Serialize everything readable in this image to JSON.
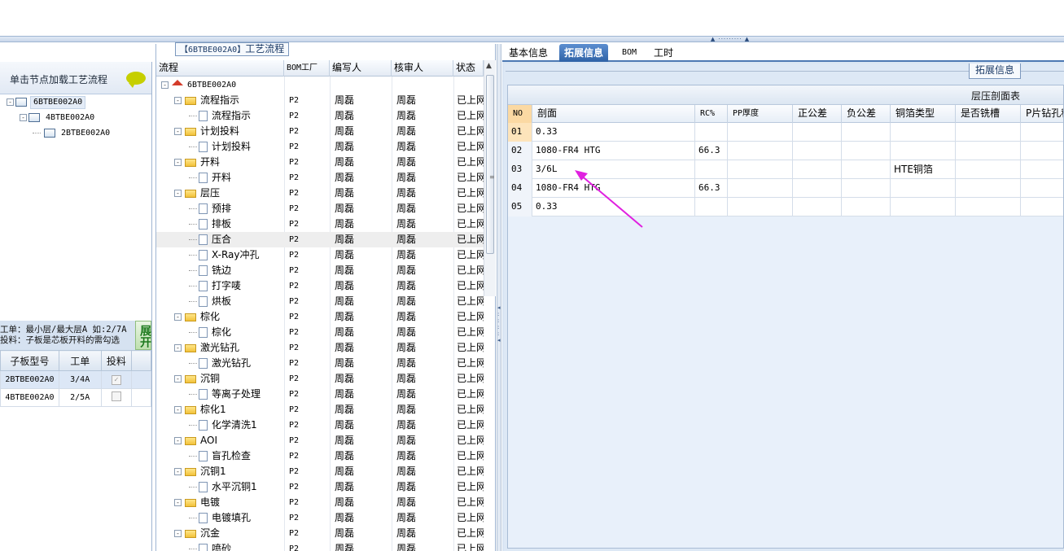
{
  "left": {
    "hint": "单击节点加载工艺流程",
    "tree": [
      {
        "label": "6BTBE002A0",
        "expander": "-",
        "level": 0,
        "selected": true
      },
      {
        "label": "4BTBE002A0",
        "expander": "-",
        "level": 1,
        "selected": false
      },
      {
        "label": "2BTBE002A0",
        "expander": "",
        "level": 2,
        "selected": false
      }
    ],
    "note_line1": "工单：最小层/最大层A 如:2/7A",
    "note_line2": "投料：子板是芯板开料的需勾选",
    "expand_label": "展开",
    "sub_headers": [
      "子板型号",
      "工单",
      "投料"
    ],
    "sub_rows": [
      {
        "model": "2BTBE002A0",
        "order": "3/4A",
        "checked": true
      },
      {
        "model": "4BTBE002A0",
        "order": "2/5A",
        "checked": false
      }
    ]
  },
  "middle": {
    "title_prefix": "【6BTBE002A0】",
    "title_suffix": "工艺流程",
    "headers": [
      "流程",
      "BOM工厂",
      "编写人",
      "核审人",
      "状态"
    ],
    "rows": [
      {
        "name": "6BTBE002A0",
        "type": "root",
        "bom": "",
        "writer": "",
        "reviewer": "",
        "status": ""
      },
      {
        "name": "流程指示",
        "type": "folder",
        "bom": "P2",
        "writer": "周磊",
        "reviewer": "周磊",
        "status": "已上网"
      },
      {
        "name": "流程指示",
        "type": "doc",
        "bom": "P2",
        "writer": "周磊",
        "reviewer": "周磊",
        "status": "已上网"
      },
      {
        "name": "计划投料",
        "type": "folder",
        "bom": "P2",
        "writer": "周磊",
        "reviewer": "周磊",
        "status": "已上网"
      },
      {
        "name": "计划投料",
        "type": "doc",
        "bom": "P2",
        "writer": "周磊",
        "reviewer": "周磊",
        "status": "已上网"
      },
      {
        "name": "开料",
        "type": "folder",
        "bom": "P2",
        "writer": "周磊",
        "reviewer": "周磊",
        "status": "已上网"
      },
      {
        "name": "开料",
        "type": "doc",
        "bom": "P2",
        "writer": "周磊",
        "reviewer": "周磊",
        "status": "已上网"
      },
      {
        "name": "层压",
        "type": "folder",
        "bom": "P2",
        "writer": "周磊",
        "reviewer": "周磊",
        "status": "已上网"
      },
      {
        "name": "预排",
        "type": "doc",
        "bom": "P2",
        "writer": "周磊",
        "reviewer": "周磊",
        "status": "已上网"
      },
      {
        "name": "排板",
        "type": "doc",
        "bom": "P2",
        "writer": "周磊",
        "reviewer": "周磊",
        "status": "已上网"
      },
      {
        "name": "压合",
        "type": "doc",
        "bom": "P2",
        "writer": "周磊",
        "reviewer": "周磊",
        "status": "已上网",
        "selected": true
      },
      {
        "name": "X-Ray冲孔",
        "type": "doc",
        "bom": "P2",
        "writer": "周磊",
        "reviewer": "周磊",
        "status": "已上网"
      },
      {
        "name": "铣边",
        "type": "doc",
        "bom": "P2",
        "writer": "周磊",
        "reviewer": "周磊",
        "status": "已上网"
      },
      {
        "name": "打字唛",
        "type": "doc",
        "bom": "P2",
        "writer": "周磊",
        "reviewer": "周磊",
        "status": "已上网"
      },
      {
        "name": "烘板",
        "type": "doc",
        "bom": "P2",
        "writer": "周磊",
        "reviewer": "周磊",
        "status": "已上网"
      },
      {
        "name": "棕化",
        "type": "folder",
        "bom": "P2",
        "writer": "周磊",
        "reviewer": "周磊",
        "status": "已上网"
      },
      {
        "name": "棕化",
        "type": "doc",
        "bom": "P2",
        "writer": "周磊",
        "reviewer": "周磊",
        "status": "已上网"
      },
      {
        "name": "激光钻孔",
        "type": "folder",
        "bom": "P2",
        "writer": "周磊",
        "reviewer": "周磊",
        "status": "已上网"
      },
      {
        "name": "激光钻孔",
        "type": "doc",
        "bom": "P2",
        "writer": "周磊",
        "reviewer": "周磊",
        "status": "已上网"
      },
      {
        "name": "沉铜",
        "type": "folder",
        "bom": "P2",
        "writer": "周磊",
        "reviewer": "周磊",
        "status": "已上网"
      },
      {
        "name": "等离子处理",
        "type": "doc",
        "bom": "P2",
        "writer": "周磊",
        "reviewer": "周磊",
        "status": "已上网"
      },
      {
        "name": "棕化1",
        "type": "folder",
        "bom": "P2",
        "writer": "周磊",
        "reviewer": "周磊",
        "status": "已上网"
      },
      {
        "name": "化学清洗1",
        "type": "doc",
        "bom": "P2",
        "writer": "周磊",
        "reviewer": "周磊",
        "status": "已上网"
      },
      {
        "name": "AOI",
        "type": "folder",
        "bom": "P2",
        "writer": "周磊",
        "reviewer": "周磊",
        "status": "已上网"
      },
      {
        "name": "盲孔检查",
        "type": "doc",
        "bom": "P2",
        "writer": "周磊",
        "reviewer": "周磊",
        "status": "已上网"
      },
      {
        "name": "沉铜1",
        "type": "folder",
        "bom": "P2",
        "writer": "周磊",
        "reviewer": "周磊",
        "status": "已上网"
      },
      {
        "name": "水平沉铜1",
        "type": "doc",
        "bom": "P2",
        "writer": "周磊",
        "reviewer": "周磊",
        "status": "已上网"
      },
      {
        "name": "电镀",
        "type": "folder",
        "bom": "P2",
        "writer": "周磊",
        "reviewer": "周磊",
        "status": "已上网"
      },
      {
        "name": "电镀填孔",
        "type": "doc",
        "bom": "P2",
        "writer": "周磊",
        "reviewer": "周磊",
        "status": "已上网"
      },
      {
        "name": "沉金",
        "type": "folder",
        "bom": "P2",
        "writer": "周磊",
        "reviewer": "周磊",
        "status": "已上网"
      },
      {
        "name": "喷砂",
        "type": "doc",
        "bom": "P2",
        "writer": "周磊",
        "reviewer": "周磊",
        "status": "已上网"
      }
    ]
  },
  "right": {
    "tabs": [
      {
        "label": "基本信息",
        "active": false
      },
      {
        "label": "拓展信息",
        "active": true
      },
      {
        "label": "BOM",
        "active": false
      },
      {
        "label": "工时",
        "active": false
      }
    ],
    "group_title": "拓展信息",
    "table_caption": "层压剖面表",
    "headers": [
      "NO",
      "剖面",
      "RC%",
      "PP厚度",
      "正公差",
      "负公差",
      "铜箔类型",
      "是否铣槽",
      "P片钻孔种"
    ],
    "rows": [
      {
        "no": "01",
        "section": "0.33",
        "rc": "",
        "pp": "",
        "pos": "",
        "neg": "",
        "foil": "",
        "slot": "",
        "drill": ""
      },
      {
        "no": "02",
        "section": "1080-FR4 HTG",
        "rc": "66.3",
        "pp": "",
        "pos": "",
        "neg": "",
        "foil": "",
        "slot": "",
        "drill": ""
      },
      {
        "no": "03",
        "section": "3/6L",
        "rc": "",
        "pp": "",
        "pos": "",
        "neg": "",
        "foil": "HTE铜箔",
        "slot": "",
        "drill": ""
      },
      {
        "no": "04",
        "section": "1080-FR4 HTG",
        "rc": "66.3",
        "pp": "",
        "pos": "",
        "neg": "",
        "foil": "",
        "slot": "",
        "drill": ""
      },
      {
        "no": "05",
        "section": "0.33",
        "rc": "",
        "pp": "",
        "pos": "",
        "neg": "",
        "foil": "",
        "slot": "",
        "drill": ""
      }
    ],
    "annotation_color": "#e020e0"
  }
}
